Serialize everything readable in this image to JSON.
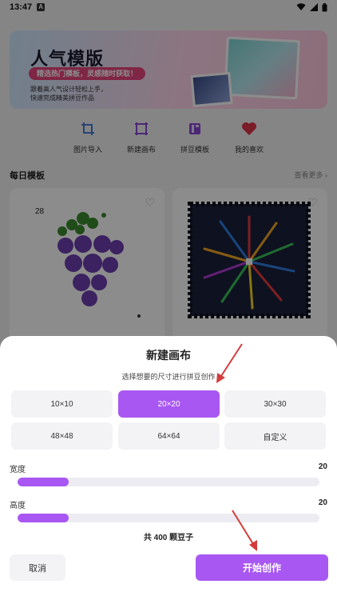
{
  "status": {
    "time": "13:47",
    "badge": "A"
  },
  "banner": {
    "title": "人气模版",
    "pill": "精选热门模板，灵感随时获取！",
    "sub_line1": "跟着高人气设计轻松上手，",
    "sub_line2": "快速完成精美拼豆作品"
  },
  "quick_actions": [
    {
      "label": "图片导入",
      "icon": "crop-icon",
      "color": "#4a7bd9"
    },
    {
      "label": "新建画布",
      "icon": "canvas-icon",
      "color": "#8a48d8"
    },
    {
      "label": "拼豆模板",
      "icon": "template-icon",
      "color": "#8a48d8"
    },
    {
      "label": "我的喜欢",
      "icon": "heart-icon",
      "color": "#e0344c"
    }
  ],
  "daily": {
    "title": "每日模板",
    "more": "查看更多"
  },
  "cards": [
    {
      "number": "28"
    },
    {
      "number": ""
    }
  ],
  "sheet": {
    "title": "新建画布",
    "subtitle": "选择想要的尺寸进行拼豆创作",
    "sizes": [
      {
        "label": "10×10",
        "selected": false
      },
      {
        "label": "20×20",
        "selected": true
      },
      {
        "label": "30×30",
        "selected": false
      },
      {
        "label": "48×48",
        "selected": false
      },
      {
        "label": "64×64",
        "selected": false
      },
      {
        "label": "自定义",
        "selected": false
      }
    ],
    "width": {
      "label": "宽度",
      "value": "20",
      "fraction": 0.17
    },
    "height": {
      "label": "高度",
      "value": "20",
      "fraction": 0.17
    },
    "total": "共 400 颗豆子",
    "cancel": "取消",
    "start": "开始创作"
  },
  "accent_color": "#a857f2",
  "annotation_color": "#d43b3b"
}
